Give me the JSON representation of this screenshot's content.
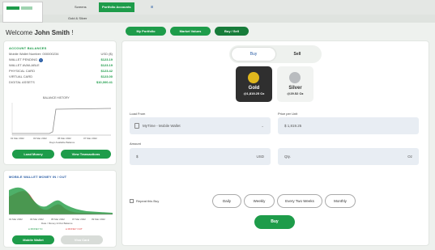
{
  "tabs": {
    "items": [
      "Screens",
      "Portfolio Accounts"
    ],
    "sub_items": [
      "Gold & Silver"
    ]
  },
  "welcome": {
    "prefix": "Welcome",
    "name": "John Smith",
    "suffix": "!"
  },
  "account": {
    "title": "ACCOUNT BALANCES",
    "rows": [
      {
        "label": "Mobile Wallet Number: 000000234",
        "value": "USD ($)"
      },
      {
        "label": "WALLET PENDING",
        "value": "$123.19"
      },
      {
        "label": "WALLET AVAILABLE",
        "value": "$123.19"
      },
      {
        "label": "PHYSICAL CARD",
        "value": "$123.42"
      },
      {
        "label": "VIRTUAL CARD",
        "value": "$123.00"
      },
      {
        "label": "DIGITAL ASSETS",
        "value": "$10,000.41"
      }
    ],
    "chart_title": "BALANCE HISTORY",
    "x_ticks": [
      "01 Mar 2022",
      "03 Mar 2022",
      "05 Mar 2022",
      "07 Mar 2022"
    ],
    "x_caption": "Days Available Balance",
    "load_money": "Load Money",
    "view_transactions": "View Transactions"
  },
  "wallet": {
    "title": "MOBILE WALLET MONEY IN / OUT",
    "x_ticks": [
      "01 Mar 2022",
      "03 Mar 2022",
      "05 Mar 2022",
      "07 Mar 2022",
      "09 Mar 2022"
    ],
    "x_caption": "Date / Money In/Out Balance",
    "legend_in": "MONEY IN",
    "legend_out": "MONEY OUT",
    "btn_mobile": "Mobile Wallet",
    "btn_card": "Visa Card"
  },
  "main": {
    "top_buttons": [
      "My Portfolio",
      "Market Values",
      "Buy / Sell"
    ],
    "toggle": [
      "Buy",
      "Sell"
    ],
    "metals": [
      {
        "name": "Gold",
        "price": "@1,819.25 Oz"
      },
      {
        "name": "Silver",
        "price": "@29.52 Oz"
      }
    ],
    "load_from_label": "Load From",
    "load_from_value": "MyTime - Mobile Wallet",
    "price_label": "Price per Unit",
    "price_value": "$ 1,819.25",
    "amount_label": "Amount",
    "amount_prefix": "$",
    "amount_suffix": "USD",
    "qty_label": "Qty.",
    "qty_suffix": "Oz",
    "repeat_label": "Repeat this Buy",
    "frequencies": [
      "Daily",
      "Weekly",
      "Every Two Weeks",
      "Monthly"
    ],
    "buy_button": "Buy"
  },
  "colors": {
    "accent": "#1e9c4a",
    "gold": "#e0b81d",
    "silver": "#b9bcbf",
    "gold_card_bg": "#2f2f2f"
  }
}
